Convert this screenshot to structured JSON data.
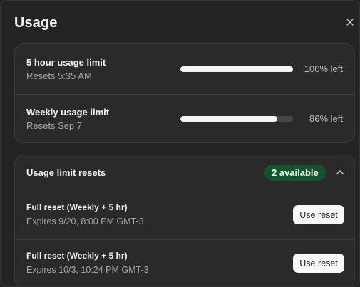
{
  "dialog": {
    "title": "Usage",
    "close_icon": "close-icon"
  },
  "usage": {
    "rows": [
      {
        "title": "5 hour usage limit",
        "subtitle": "Resets 5:35 AM",
        "fraction_left": 1.0,
        "percent_label": "100% left"
      },
      {
        "title": "Weekly usage limit",
        "subtitle": "Resets Sep 7",
        "fraction_left": 0.86,
        "percent_label": "86% left"
      }
    ]
  },
  "resets": {
    "title": "Usage limit resets",
    "badge": "2 available",
    "badge_color": "#14532d",
    "chevron_icon": "chevron-up-icon",
    "items": [
      {
        "title": "Full reset (Weekly + 5 hr)",
        "expires": "Expires 9/20, 8:00 PM GMT-3",
        "button": "Use reset"
      },
      {
        "title": "Full reset (Weekly + 5 hr)",
        "expires": "Expires 10/3, 10:24 PM GMT-3",
        "button": "Use reset"
      }
    ]
  }
}
